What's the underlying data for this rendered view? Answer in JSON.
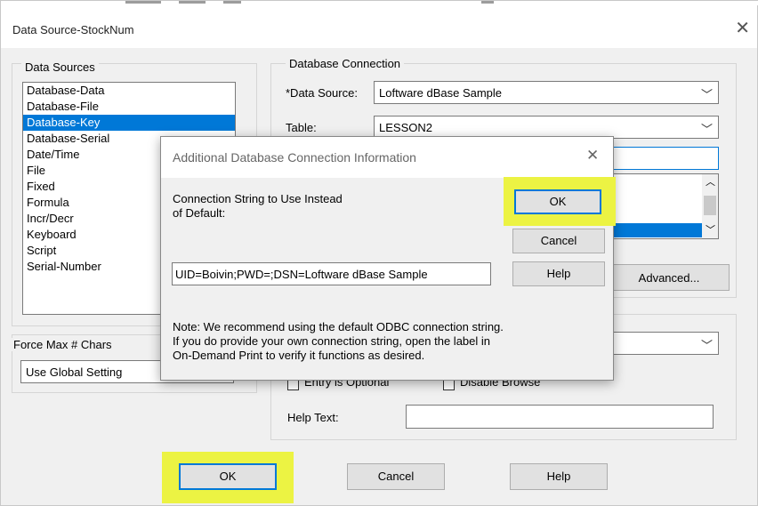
{
  "window": {
    "title": "Data Source-StockNum",
    "close_glyph": "✕"
  },
  "data_sources": {
    "group_label": "Data Sources",
    "items": [
      {
        "label": "Database-Data",
        "selected": false
      },
      {
        "label": "Database-File",
        "selected": false
      },
      {
        "label": "Database-Key",
        "selected": true
      },
      {
        "label": "Database-Serial",
        "selected": false
      },
      {
        "label": "Date/Time",
        "selected": false
      },
      {
        "label": "File",
        "selected": false
      },
      {
        "label": "Fixed",
        "selected": false
      },
      {
        "label": "Formula",
        "selected": false
      },
      {
        "label": "Incr/Decr",
        "selected": false
      },
      {
        "label": "Keyboard",
        "selected": false
      },
      {
        "label": "Script",
        "selected": false
      },
      {
        "label": "Serial-Number",
        "selected": false
      }
    ]
  },
  "force_max": {
    "label": "Force Max # Chars",
    "value": "Use Global Setting"
  },
  "db_connection": {
    "group_label": "Database  Connection",
    "data_source_label": "*Data Source:",
    "data_source_value": "Loftware dBase Sample",
    "table_label": "Table:",
    "table_value": "LESSON2",
    "advanced_label": "Advanced..."
  },
  "entry": {
    "optional_label": "Entry is Optional",
    "disable_browse_label": "Disable Browse",
    "help_text_label": "Help Text:",
    "help_text_value": ""
  },
  "footer": {
    "ok_label": "OK",
    "cancel_label": "Cancel",
    "help_label": "Help"
  },
  "dialog": {
    "title": "Additional Database Connection Information",
    "close_glyph": "✕",
    "prompt_line1": "Connection String to Use Instead",
    "prompt_line2": "of Default:",
    "ok_label": "OK",
    "cancel_label": "Cancel",
    "help_label": "Help",
    "connection_string": "UID=Boivin;PWD=;DSN=Loftware dBase Sample",
    "note_line1": "Note:  We recommend using the default ODBC connection string.",
    "note_line2": "If you do provide your own connection string, open the label in",
    "note_line3": "On-Demand Print to verify it functions as desired."
  },
  "colors": {
    "highlight": "#ecf343",
    "selection": "#0078d7"
  },
  "icons": {
    "dropdown": "chevron-down-icon",
    "close": "close-icon"
  }
}
